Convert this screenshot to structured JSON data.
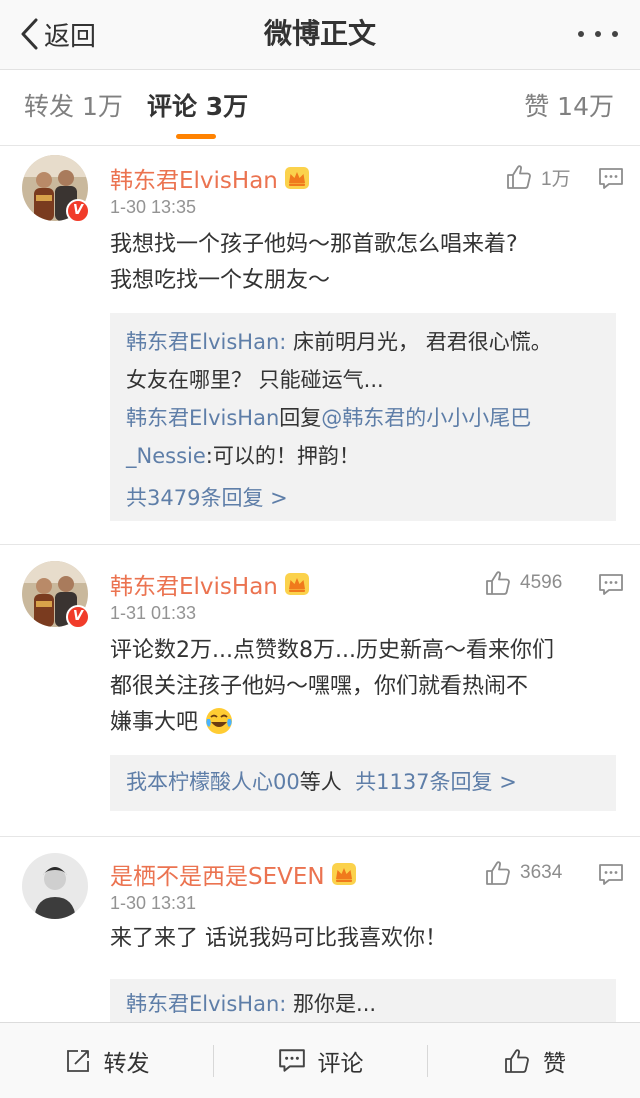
{
  "nav": {
    "back_label": "返回",
    "title": "微博正文"
  },
  "tabs": {
    "repost": "转发 1万",
    "comment": "评论 3万",
    "like": "赞 14万"
  },
  "colors": {
    "accent": "#ff8200",
    "username": "#eb7350",
    "link": "#5e7ea8",
    "verified_badge": "#f13c2a"
  },
  "comments": [
    {
      "user": "韩东君ElvisHan",
      "time": "1-30 13:35",
      "likes": "1万",
      "text": [
        "我想找一个孩子他妈～那首歌怎么唱来着?",
        "我想吃找一个女朋友～"
      ],
      "replies": [
        {
          "name": "韩东君ElvisHan:",
          "text": " 床前明月光， 君君很心慌。"
        },
        {
          "name": "",
          "text": "女友在哪里？ 只能碰运气..."
        },
        {
          "name": "韩东君ElvisHan",
          "text": "回复",
          "mention": "@韩东君的小小小尾巴"
        },
        {
          "name": "",
          "mention": "_Nessie",
          "text": ":可以的！押韵！"
        }
      ],
      "more": "共3479条回复 >"
    },
    {
      "user": "韩东君ElvisHan",
      "time": "1-31 01:33",
      "likes": "4596",
      "text": [
        "评论数2万...点赞数8万...历史新高～看来你们",
        "都很关注孩子他妈～嘿嘿，你们就看热闹不",
        "嫌事大吧"
      ],
      "replies_summary": {
        "names": "我本柠檬酸人心00",
        "suffix": "等人",
        "more": "共1137条回复 >"
      }
    },
    {
      "user": "是栖不是西是SEVEN",
      "time": "1-30 13:31",
      "likes": "3634",
      "text": [
        "来了来了 话说我妈可比我喜欢你！"
      ],
      "replies": [
        {
          "name": "韩东君ElvisHan:",
          "text": " 那你是..."
        }
      ]
    }
  ],
  "bottom": {
    "repost": "转发",
    "comment": "评论",
    "like": "赞"
  },
  "icons": {
    "back": "chevron-left-icon",
    "more": "more-dots-icon",
    "like": "thumbs-up-icon",
    "reply": "comment-bubble-icon",
    "crown": "vip-crown-icon",
    "verified": "verified-v-icon",
    "repost": "repost-icon",
    "emoji": "laughing-tears-emoji"
  }
}
